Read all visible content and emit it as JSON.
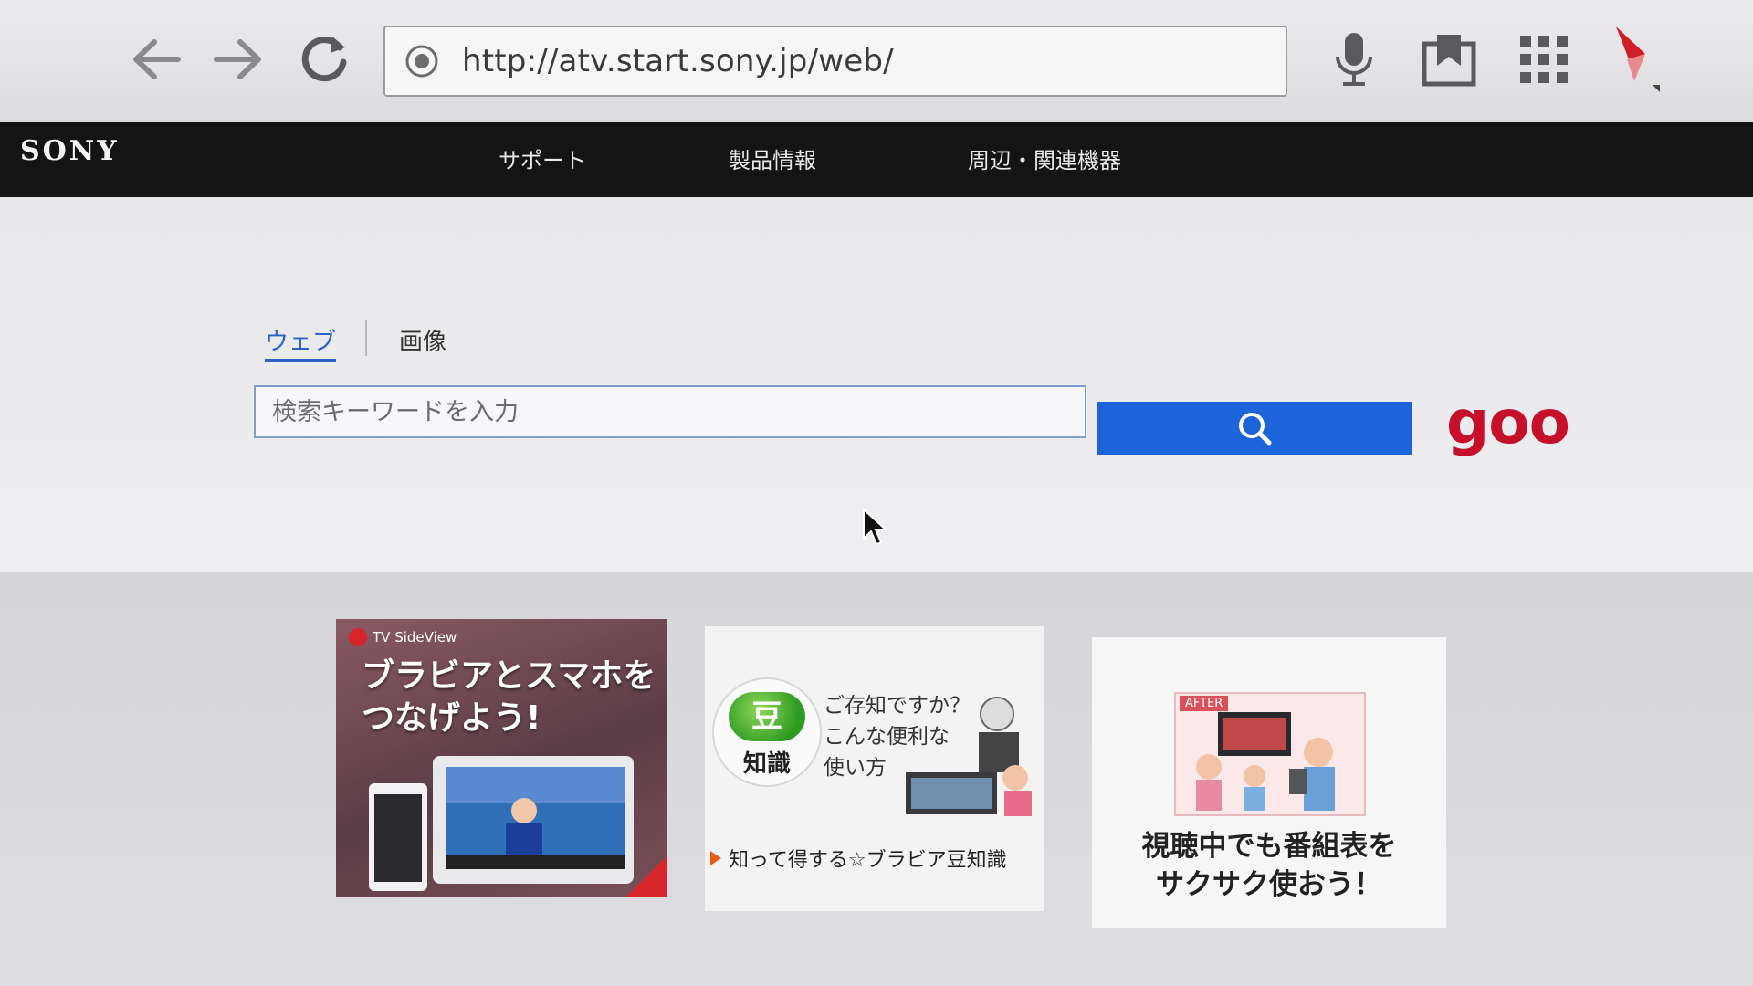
{
  "browser": {
    "url": "http://atv.start.sony.jp/web/",
    "buttons": [
      "back",
      "forward",
      "reload",
      "voice",
      "bookmarks",
      "apps",
      "menu"
    ]
  },
  "site": {
    "logo": "SONY",
    "nav": [
      "サポート",
      "製品情報",
      "周辺・関連機器"
    ]
  },
  "search": {
    "tabs": [
      "ウェブ",
      "画像"
    ],
    "active_tab": "ウェブ",
    "placeholder": "検索キーワードを入力",
    "value": "",
    "provider_logo": "goo"
  },
  "cards": [
    {
      "badge": "TV SideView",
      "headline_line1": "ブラビアとスマホを",
      "headline_line2": "つなげよう!"
    },
    {
      "bean_char": "豆",
      "bean_label": "知識",
      "question_line1": "ご存知ですか？",
      "question_line2": "こんな便利な",
      "question_line3": "使い方",
      "link_text": "知って得する☆ブラビア豆知識"
    },
    {
      "image_tag": "AFTER",
      "caption_line1": "視聴中でも番組表を",
      "caption_line2": "サクサク使おう！"
    }
  ],
  "colors": {
    "accent_blue": "#1d63d9",
    "goo_red": "#c6102b",
    "header_bg": "#141414"
  }
}
